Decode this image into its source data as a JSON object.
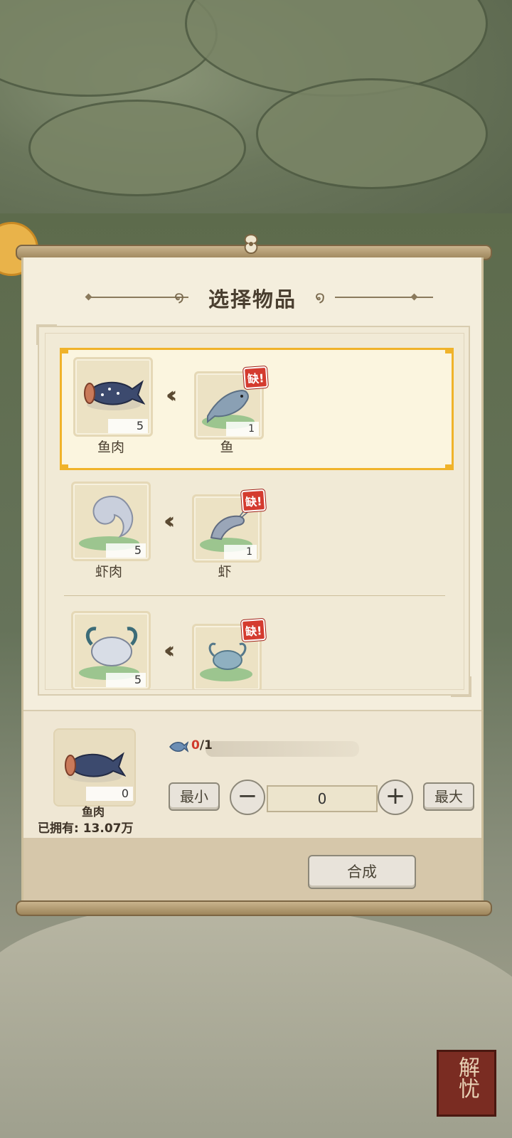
{
  "dialog": {
    "title": "选择物品",
    "recipes": [
      {
        "output_name": "鱼肉",
        "output_count": "5",
        "output_icon": "fish-meat-icon",
        "input_name": "鱼",
        "input_count": "1",
        "input_icon": "fish-icon",
        "lack_label": "缺!",
        "selected": true
      },
      {
        "output_name": "虾肉",
        "output_count": "5",
        "output_icon": "shrimp-meat-icon",
        "input_name": "虾",
        "input_count": "1",
        "input_icon": "shrimp-icon",
        "lack_label": "缺!",
        "selected": false
      },
      {
        "output_name": "",
        "output_count": "5",
        "output_icon": "crab-meat-icon",
        "input_name": "",
        "input_count": "",
        "input_icon": "crab-icon",
        "lack_label": "缺!",
        "selected": false
      }
    ]
  },
  "selection": {
    "item_name": "鱼肉",
    "item_count": "0",
    "owned_text": "已拥有: 13.07万",
    "progress_have": "0",
    "progress_need": "/1",
    "min_label": "最小",
    "max_label": "最大",
    "quantity": "0",
    "decrease_label": "−",
    "increase_label": "+"
  },
  "footer": {
    "craft_label": "合成"
  },
  "scene": {
    "corner_seal_text": "解忧"
  },
  "colors": {
    "highlight": "#f0b32a",
    "lack_badge": "#d43b2f",
    "paper": "#f4eedd"
  }
}
